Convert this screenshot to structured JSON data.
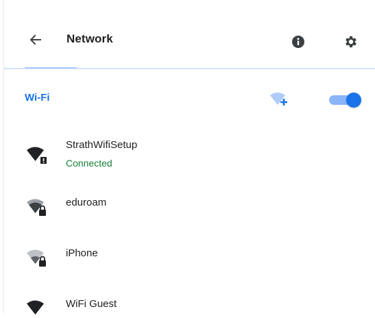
{
  "header": {
    "title": "Network",
    "back_icon": "arrow-back-icon",
    "info_icon": "info-icon",
    "settings_icon": "gear-icon"
  },
  "wifi": {
    "label": "Wi-Fi",
    "add_icon": "add-wifi-icon",
    "toggle_on": true
  },
  "networks": [
    {
      "name": "StrathWifiSetup",
      "status": "Connected",
      "icon": "wifi-warning-icon"
    },
    {
      "name": "eduroam",
      "status": "",
      "icon": "wifi-lock-icon"
    },
    {
      "name": "iPhone",
      "status": "",
      "icon": "wifi-lock-icon"
    },
    {
      "name": "WiFi Guest",
      "status": "",
      "icon": "wifi-icon"
    }
  ],
  "colors": {
    "accent": "#1a73e8",
    "connected": "#188038",
    "text": "#202124",
    "icon_dark": "#202124",
    "icon_muted": "#9aa0a6"
  }
}
